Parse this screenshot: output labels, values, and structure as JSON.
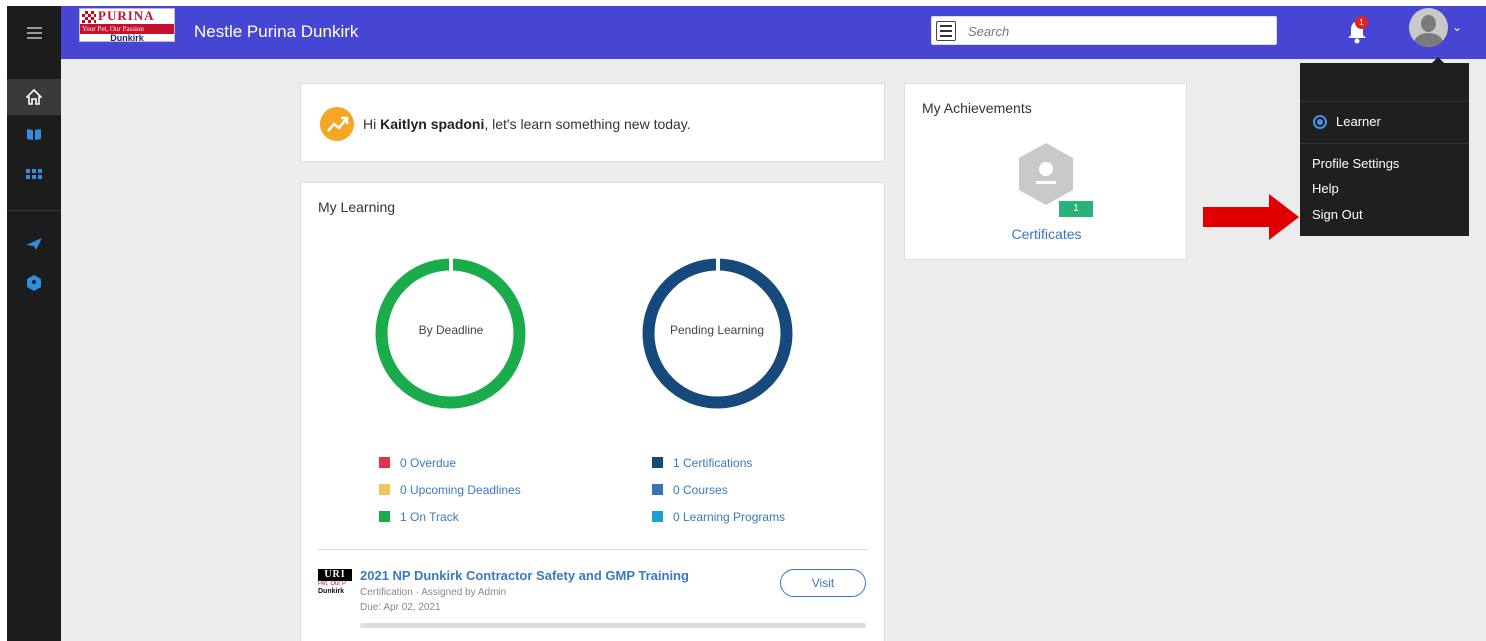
{
  "header": {
    "title": "Nestle Purina Dunkirk",
    "logo": {
      "brand": "PURINA",
      "tagline": "Your Pet, Our Passion",
      "location": "Dunkirk"
    },
    "search_placeholder": "Search",
    "notification_count": "1"
  },
  "sidebar": {
    "items": [
      {
        "icon": "home-icon",
        "active": true
      },
      {
        "icon": "book-icon"
      },
      {
        "icon": "grid-icon"
      },
      {
        "icon": "send-icon"
      },
      {
        "icon": "hexagon-icon"
      }
    ]
  },
  "welcome": {
    "greeting": "Hi",
    "user_name": "Kaitlyn spadoni",
    "message": ", let's learn something new today."
  },
  "my_learning": {
    "title": "My Learning",
    "deadline_chart": {
      "label": "By Deadline",
      "legend": [
        {
          "text": "0 Overdue",
          "color": "#e0344b"
        },
        {
          "text": "0 Upcoming Deadlines",
          "color": "#f2c55c"
        },
        {
          "text": "1 On Track",
          "color": "#1aab4b"
        }
      ]
    },
    "pending_chart": {
      "label": "Pending Learning",
      "legend": [
        {
          "text": "1 Certifications",
          "color": "#174a7c"
        },
        {
          "text": "0 Courses",
          "color": "#3d72b3"
        },
        {
          "text": "0 Learning Programs",
          "color": "#1a9fd6"
        }
      ]
    },
    "course": {
      "title": "2021 NP Dunkirk Contractor Safety and GMP Training",
      "meta": "Certification · Assigned by Admin",
      "due": "Due: Apr 02, 2021",
      "visit_label": "Visit",
      "thumb_brand": "URI",
      "thumb_tagline": "Pet, Our P",
      "thumb_location": "Dunkirk"
    }
  },
  "achievements": {
    "title": "My Achievements",
    "count": "1",
    "link": "Certificates"
  },
  "user_menu": {
    "role": "Learner",
    "items": [
      "Profile Settings",
      "Help",
      "Sign Out"
    ]
  },
  "colors": {
    "header": "#4746d4",
    "sidebar": "#1c1c1c",
    "deadline_ring": "#1aab4b",
    "pending_ring": "#174a7c",
    "link": "#3b78c3",
    "annotation_arrow": "#e00000"
  }
}
